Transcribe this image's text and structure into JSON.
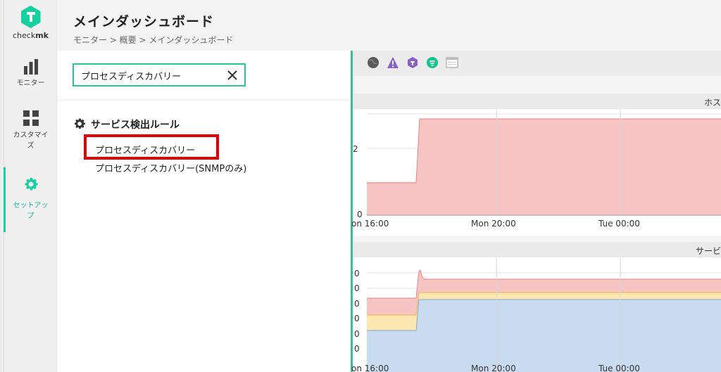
{
  "app": {
    "logo_text_light": "check",
    "logo_text_bold": "mk",
    "logo_color": "#15d1a0"
  },
  "sidebar": {
    "items": [
      {
        "label": "モニター",
        "icon": "bar-chart-icon",
        "active": false
      },
      {
        "label": "カスタマイズ",
        "icon": "grid-icon",
        "active": false
      },
      {
        "label": "セットアップ",
        "icon": "gear-icon",
        "active": true
      }
    ]
  },
  "header": {
    "title": "メインダッシュボード",
    "breadcrumb": "モニター > 概要 > メインダッシュボード"
  },
  "search": {
    "value": "プロセスディスカバリー",
    "clear_icon": "close-icon"
  },
  "results": {
    "section_title": "サービス検出ルール",
    "section_icon": "gear-icon",
    "items": [
      {
        "label": "プロセスディスカバリー",
        "highlighted": true
      },
      {
        "label": "プロセスディスカバリー(SNMPのみ)",
        "highlighted": false
      }
    ],
    "highlight_color": "#e00000"
  },
  "dashboard": {
    "toolbar_icons": [
      "globe-icon",
      "warning-icon",
      "hexagon-icon",
      "filter-icon",
      "window-icon"
    ],
    "graphs": [
      {
        "title": "ホス",
        "x_ticks": [
          "on 16:00",
          "Mon 20:00",
          "Tue 00:00"
        ],
        "y_ticks": [
          "2",
          "0"
        ]
      },
      {
        "title": "サービ",
        "x_ticks": [
          "on 16:00",
          "Mon 20:00",
          "Tue 00:00"
        ],
        "y_ticks": [
          "0",
          "0",
          "0",
          "0",
          "0",
          "0"
        ]
      }
    ]
  },
  "chart_data": [
    {
      "type": "area",
      "title": "ホス",
      "x": [
        "on 16:00",
        "Mon 20:00",
        "Tue 00:00"
      ],
      "series": [
        {
          "values": [
            1,
            1,
            3,
            3,
            3,
            3
          ],
          "color": "#f7c4c4"
        }
      ],
      "ylim": [
        0,
        3
      ]
    },
    {
      "type": "area",
      "title": "サービ",
      "x": [
        "on 16:00",
        "Mon 20:00",
        "Tue 00:00"
      ],
      "series": [
        {
          "color": "#c9dcef"
        },
        {
          "color": "#fbe9a6"
        },
        {
          "color": "#f7c4c4"
        }
      ]
    }
  ]
}
